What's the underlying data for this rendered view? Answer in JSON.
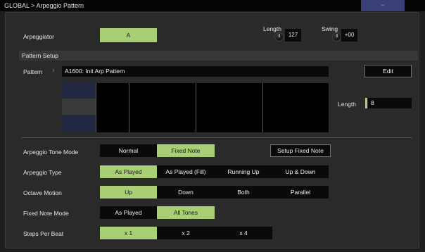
{
  "header": {
    "breadcrumb": "GLOBAL > Arpeggio Pattern",
    "menu_icon": "chevron-down-icon"
  },
  "arpeggiator": {
    "label": "Arpeggiator",
    "value": "A"
  },
  "length_ctrl": {
    "label": "Length",
    "value": "127"
  },
  "swing_ctrl": {
    "label": "Swing",
    "value": "+00"
  },
  "pattern_setup": {
    "section_title": "Pattern Setup",
    "pattern_label": "Pattern",
    "pattern_value": "A1600: Init Arp Pattern",
    "edit_label": "Edit",
    "length_label": "Length",
    "length_value": "8"
  },
  "tone_mode": {
    "label": "Arpeggio Tone Mode",
    "options": [
      "Normal",
      "Fixed Note"
    ],
    "selected": "Fixed Note",
    "setup_button": "Setup Fixed Note"
  },
  "arp_type": {
    "label": "Arpeggio Type",
    "options": [
      "As Played",
      "As Played (Fill)",
      "Running Up",
      "Up & Down"
    ],
    "selected": "As Played"
  },
  "octave_motion": {
    "label": "Octave Motion",
    "options": [
      "Up",
      "Down",
      "Both",
      "Parallel"
    ],
    "selected": "Up"
  },
  "fixed_note_mode": {
    "label": "Fixed Note Mode",
    "options": [
      "As Played",
      "All Tones"
    ],
    "selected": "All Tones"
  },
  "steps_per_beat": {
    "label": "Steps Per Beat",
    "options": [
      "x 1",
      "x 2",
      "x 4"
    ],
    "selected": "x 1"
  },
  "colors": {
    "accent": "#a8cf73",
    "chevron": "#d04a8a",
    "menu_bg": "#3a3f77"
  }
}
